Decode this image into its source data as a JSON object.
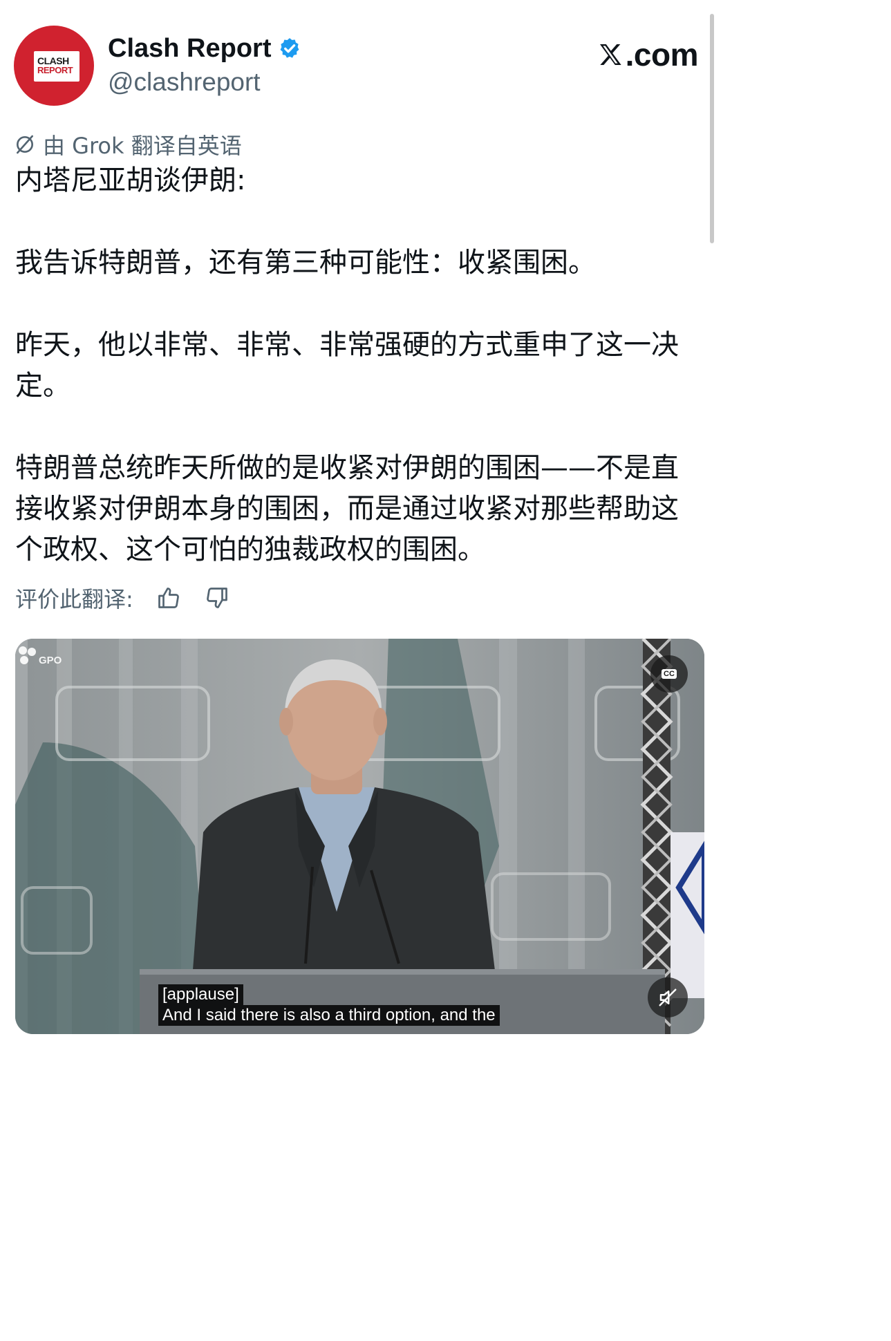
{
  "account": {
    "name": "Clash Report",
    "handle": "@clashreport",
    "verified": true,
    "avatar": {
      "line1": "CLASH",
      "line2": "REPORT"
    }
  },
  "brand": {
    "suffix": ".com"
  },
  "translation": {
    "notice": "由 Grok 翻译自英语",
    "icon": "translate-icon"
  },
  "tweet": {
    "paragraphs": [
      "内塔尼亚胡谈伊朗:",
      "我告诉特朗普，还有第三种可能性：收紧围困。",
      "昨天，他以非常、非常、非常强硬的方式重申了这一决定。",
      "特朗普总统昨天所做的是收紧对伊朗的围困——不是直接收紧对伊朗本身的围困，而是通过收紧对那些帮助这个政权、这个可怕的独裁政权的围困。"
    ]
  },
  "rating": {
    "label": "评价此翻译:"
  },
  "video": {
    "watermark": "GPO",
    "cc_label": "CC",
    "subtitle_line1": "[applause]",
    "subtitle_line2": "And I said there is also a third option, and the"
  },
  "colors": {
    "text": "#0f1419",
    "secondary": "#536471",
    "verified": "#1d9bf0",
    "avatar_red": "#d0222f"
  }
}
